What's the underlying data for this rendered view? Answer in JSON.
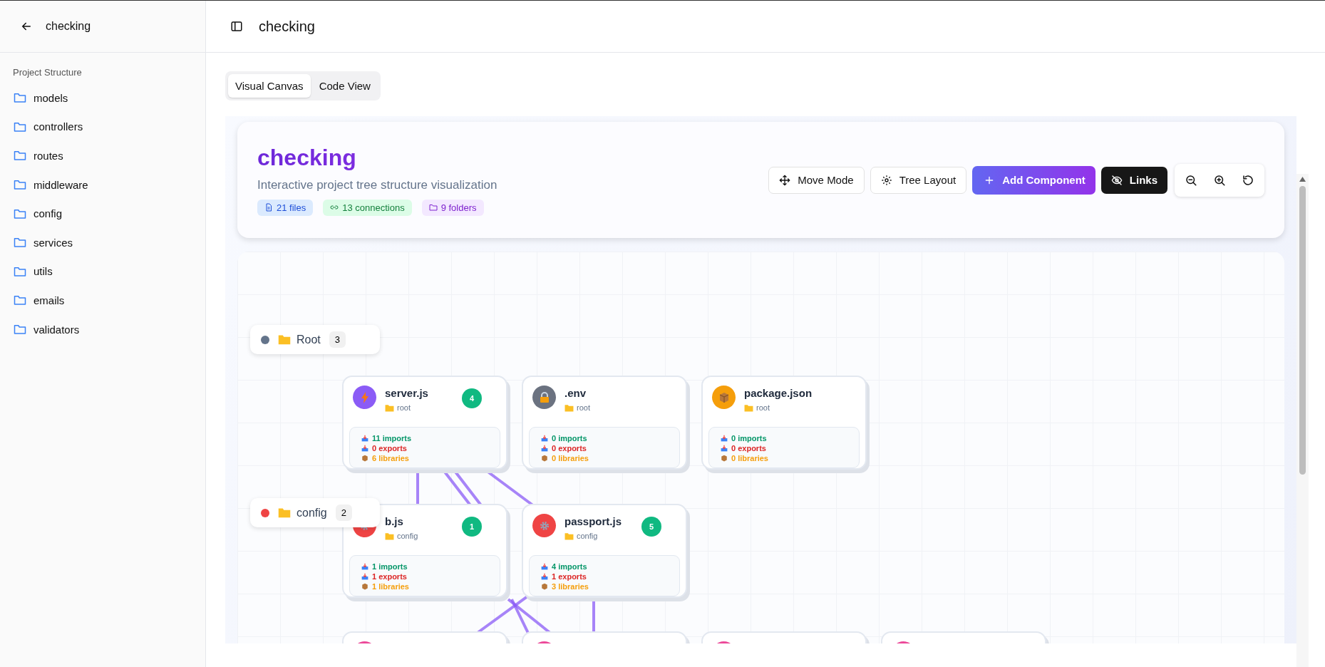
{
  "sidebar": {
    "title": "checking",
    "section": "Project Structure",
    "items": [
      {
        "label": "models"
      },
      {
        "label": "controllers"
      },
      {
        "label": "routes"
      },
      {
        "label": "middleware"
      },
      {
        "label": "config"
      },
      {
        "label": "services"
      },
      {
        "label": "utils"
      },
      {
        "label": "emails"
      },
      {
        "label": "validators"
      }
    ]
  },
  "header": {
    "title": "checking"
  },
  "tabs": [
    {
      "label": "Visual Canvas",
      "selected": true
    },
    {
      "label": "Code View",
      "selected": false
    }
  ],
  "project": {
    "title": "checking",
    "subtitle": "Interactive project tree structure visualization",
    "chips": [
      {
        "kind": "files",
        "label": "21 files"
      },
      {
        "kind": "connections",
        "label": "13 connections"
      },
      {
        "kind": "folders",
        "label": "9 folders"
      }
    ]
  },
  "toolbar": [
    {
      "kind": "move",
      "label": "Move Mode"
    },
    {
      "kind": "layout",
      "label": "Tree Layout"
    },
    {
      "kind": "add",
      "label": "Add Component"
    },
    {
      "kind": "links",
      "label": "Links"
    }
  ],
  "groups": [
    {
      "label": "Root",
      "count": "3",
      "color": "#64748b"
    },
    {
      "label": "config",
      "count": "2",
      "color": "#ef4444"
    }
  ],
  "nodes": [
    {
      "kind": "script",
      "color": "#8b5cf6",
      "name": "server.js",
      "folder": "root",
      "badge": "4",
      "imports": "11 imports",
      "exports": "0 exports",
      "libraries": "6 libraries"
    },
    {
      "kind": "env",
      "color": "#6b7280",
      "name": ".env",
      "folder": "root",
      "imports": "0 imports",
      "exports": "0 exports",
      "libraries": "0 libraries"
    },
    {
      "kind": "manifest",
      "color": "#f59e0b",
      "name": "package.json",
      "folder": "root",
      "imports": "0 imports",
      "exports": "0 exports",
      "libraries": "0 libraries"
    },
    {
      "kind": "config",
      "color": "#ef4444",
      "name": "b.js",
      "folder": "config",
      "badge": "1",
      "imports": "1 imports",
      "exports": "1 exports",
      "libraries": "1 libraries"
    },
    {
      "kind": "config",
      "color": "#ef4444",
      "name": "passport.js",
      "folder": "config",
      "badge": "5",
      "imports": "4 imports",
      "exports": "1 exports",
      "libraries": "3 libraries"
    },
    {
      "kind": "clipped",
      "color": "#ec4899"
    },
    {
      "kind": "clipped",
      "color": "#ec4899"
    },
    {
      "kind": "clipped",
      "color": "#ec4899"
    },
    {
      "kind": "clipped",
      "color": "#ec4899"
    }
  ]
}
